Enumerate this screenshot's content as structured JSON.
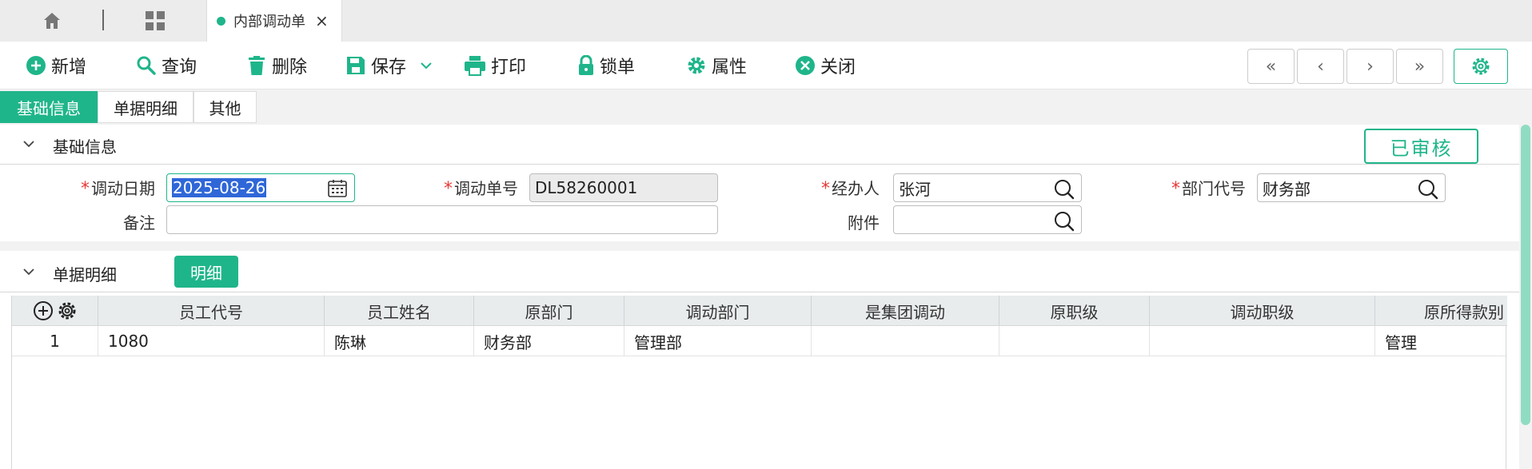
{
  "tabs": {
    "doc_tab_label": "内部调动单",
    "close_glyph": "×"
  },
  "toolbar": {
    "add": "新增",
    "query": "查询",
    "delete": "删除",
    "save": "保存",
    "print": "打印",
    "lock": "锁单",
    "properties": "属性",
    "close": "关闭",
    "nav_first": "«",
    "nav_prev": "‹",
    "nav_next": "›",
    "nav_last": "»"
  },
  "section_tabs": [
    "基础信息",
    "单据明细",
    "其他"
  ],
  "basic": {
    "title": "基础信息",
    "status": "已审核",
    "date_label": "调动日期",
    "date_value": "2025-08-26",
    "order_no_label": "调动单号",
    "order_no_value": "DL58260001",
    "handler_label": "经办人",
    "handler_value": "张河",
    "dept_code_label": "部门代号",
    "dept_code_value": "财务部",
    "remark_label": "备注",
    "remark_value": "",
    "attachment_label": "附件",
    "attachment_value": "",
    "required_mark": "*"
  },
  "detail": {
    "title": "单据明细",
    "detail_button": "明细",
    "columns": [
      "员工代号",
      "员工姓名",
      "原部门",
      "调动部门",
      "是集团调动",
      "原职级",
      "调动职级",
      "原所得款别"
    ],
    "rows": [
      {
        "index": "1",
        "cells": [
          "1080",
          "陈琳",
          "财务部",
          "管理部",
          "",
          "",
          "",
          "管理"
        ]
      }
    ]
  },
  "colors": {
    "accent": "#1fb58a",
    "required": "#e53935",
    "selection": "#2f67d8"
  }
}
